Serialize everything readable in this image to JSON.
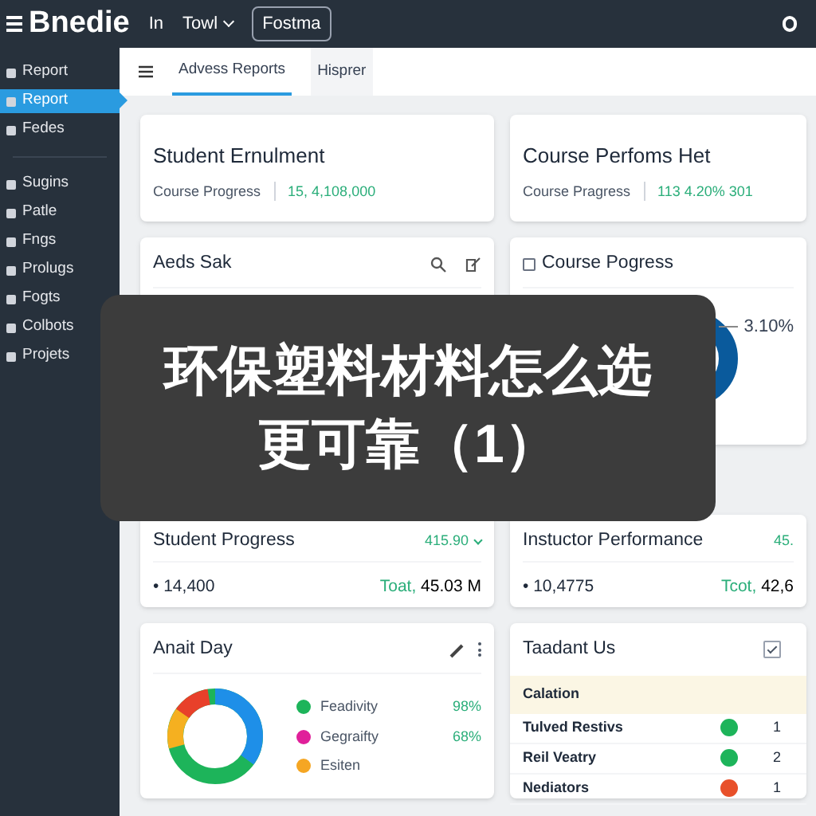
{
  "topbar": {
    "brand": "Bnedie",
    "menu": [
      {
        "label": "In"
      },
      {
        "label": "Towl",
        "dropdown": true
      },
      {
        "label": "Fostma",
        "boxed": true
      }
    ]
  },
  "sidebar": {
    "items": [
      {
        "label": "Report",
        "selected": false
      },
      {
        "label": "Report",
        "selected": true
      },
      {
        "label": "Fedes",
        "selected": false
      },
      {
        "label": "Sugins",
        "selected": false
      },
      {
        "label": "Patle",
        "selected": false
      },
      {
        "label": "Fngs",
        "selected": false
      },
      {
        "label": "Prolugs",
        "selected": false
      },
      {
        "label": "Fogts",
        "selected": false
      },
      {
        "label": "Colbots",
        "selected": false
      },
      {
        "label": "Projets",
        "selected": false
      }
    ]
  },
  "tabs": [
    {
      "label": "Advess Reports",
      "selected": true
    },
    {
      "label": "Hisprer",
      "selected": false
    }
  ],
  "summary_cards": [
    {
      "title": "Student Ernulment",
      "label": "Course Progress",
      "value": "15, 4,108,000"
    },
    {
      "title": "Course Perfoms Het",
      "label": "Course Pragress",
      "value": "113 4.20% 301"
    }
  ],
  "chart_cards": [
    {
      "title": "Aeds Sak"
    },
    {
      "title": "Course Pogress",
      "callout": "3.10%"
    }
  ],
  "progress_cards": [
    {
      "title": "Student Progress",
      "badge": "415.90",
      "count": "• 14,400",
      "total_label": "Toat,",
      "total": "45.03 M"
    },
    {
      "title": "Instuctor Performance",
      "badge": "45.",
      "count": "• 10,4775",
      "total_label": "Tcot,",
      "total": "42,6"
    }
  ],
  "activity": {
    "title": "Anait Day",
    "legend": [
      {
        "label": "Feadivity",
        "value": "98%",
        "color": "#1db45a"
      },
      {
        "label": "Gegraifty",
        "value": "68%",
        "color": "#e0209a"
      },
      {
        "label": "Esiten",
        "color": "#f5a623"
      }
    ]
  },
  "status_table": {
    "title": "Taadant Us",
    "checked": true,
    "header": "Calation",
    "rows": [
      {
        "name": "Tulved Restivs",
        "color": "#1db45a",
        "count": "1"
      },
      {
        "name": "Reil Veatry",
        "color": "#1db45a",
        "count": "2"
      },
      {
        "name": "Nediators",
        "color": "#e8502a",
        "count": "1"
      }
    ]
  },
  "overlay_caption": {
    "lines": [
      "环保塑料材料怎么选",
      "更可靠（1）"
    ]
  }
}
